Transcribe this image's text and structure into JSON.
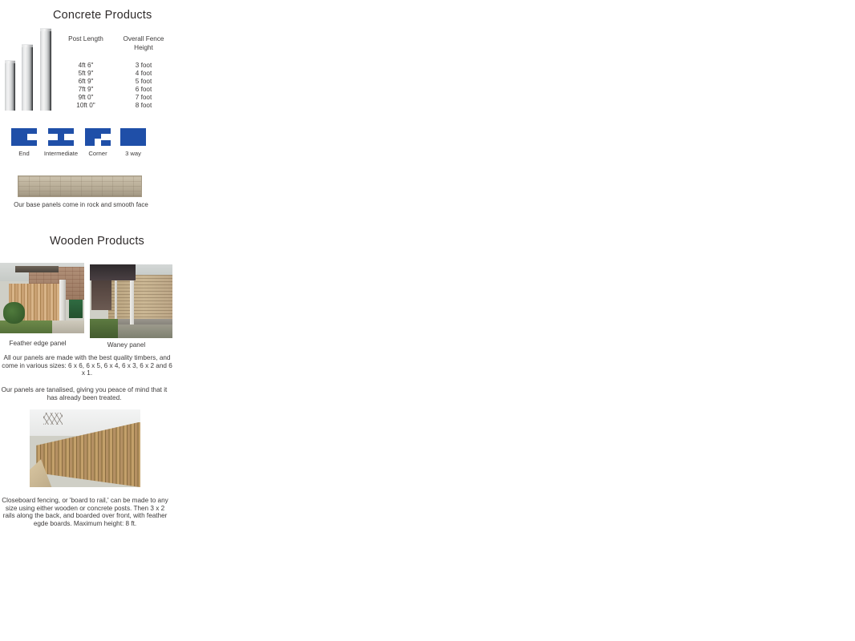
{
  "sections": {
    "concrete": {
      "heading": "Concrete Products",
      "posts_photo_alt": "concrete-posts-photo",
      "table": {
        "headers": [
          "Post Length",
          "Overall Fence Height"
        ],
        "header_lines": {
          "col_a": "Post Length",
          "col_b_line1": "Overall Fence",
          "col_b_line2": "Height"
        },
        "rows": [
          {
            "post_length": "4ft 6\"",
            "fence_height": "3 foot"
          },
          {
            "post_length": "5ft 9\"",
            "fence_height": "4 foot"
          },
          {
            "post_length": "6ft 9\"",
            "fence_height": "5 foot"
          },
          {
            "post_length": "7ft 9\"",
            "fence_height": "6 foot"
          },
          {
            "post_length": "9ft 0\"",
            "fence_height": "7 foot"
          },
          {
            "post_length": "10ft 0\"",
            "fence_height": "8 foot"
          }
        ]
      },
      "post_types": [
        {
          "label": "End",
          "icon": "post-end-icon"
        },
        {
          "label": "Intermediate",
          "icon": "post-intermediate-icon"
        },
        {
          "label": "Corner",
          "icon": "post-corner-icon"
        },
        {
          "label": "3 way",
          "icon": "post-3way-icon"
        }
      ],
      "base_panel_caption": "Our base panels come in rock and smooth face"
    },
    "wooden": {
      "heading": "Wooden Products",
      "panels": [
        {
          "caption": "Feather edge panel",
          "photo": "feather-edge-panel-photo"
        },
        {
          "caption": "Waney panel",
          "photo": "waney-panel-photo"
        }
      ],
      "panel_sizes_text": "All our panels are made with the best quality timbers, and come in various sizes:\n6 x 6, 6 x 5, 6 x 4, 6 x 3, 6 x 2 and 6 x 1.",
      "tanalised_text": "Our panels are tanalised, giving you peace of mind that it has already been treated.",
      "closeboard_photo": "closeboard-fencing-photo",
      "closeboard_text": "Closeboard fencing, or 'board to rail,' can be made to any size using either wooden or concrete posts. Then 3 x 2 rails along the back, and boarded over front, with feather egde boards. Maximum height: 8 ft."
    }
  },
  "colors": {
    "icon_blue": "#1F4FA8",
    "heading_text": "#2f2b2b",
    "body_text": "#3c3a3a",
    "page_background": "#ffffff"
  }
}
